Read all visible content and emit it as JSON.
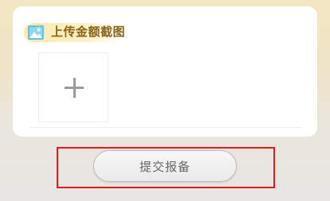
{
  "upload_section": {
    "title": "上传金额截图",
    "icon": "image-icon",
    "add_icon": "plus-icon"
  },
  "submit": {
    "label": "提交报备"
  },
  "colors": {
    "title_text": "#8a6414",
    "highlight_border": "#e8181a",
    "button_text": "#666666"
  }
}
